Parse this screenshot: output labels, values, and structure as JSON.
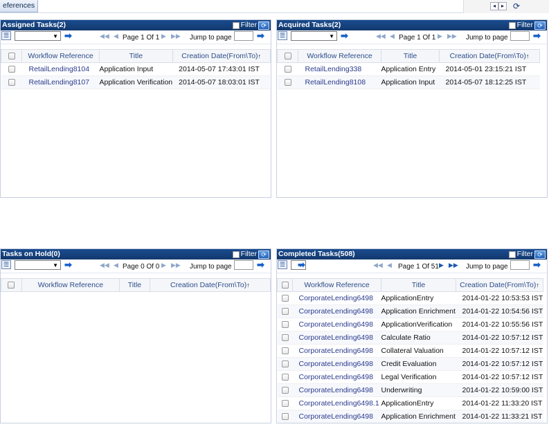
{
  "topbar": {
    "tab_label": "eferences",
    "nav_prev_icon": "◂",
    "nav_next_icon": "▸",
    "refresh_icon": "⟳"
  },
  "common": {
    "filter_label": "Filter",
    "jump_label": "Jump to page",
    "columns": [
      "Workflow Reference",
      "Title",
      "Creation Date(From\\To)"
    ],
    "sort_icon": "↑"
  },
  "panels": {
    "assigned": {
      "title": "Assigned Tasks(2)",
      "page_text": "Page 1 Of 1",
      "rows": [
        {
          "ref": "RetailLending8104",
          "title": "Application Input",
          "date": "2014-05-07 17:43:01 IST"
        },
        {
          "ref": "RetailLending8107",
          "title": "Application Verification",
          "date": "2014-05-07 18:03:01 IST"
        }
      ]
    },
    "acquired": {
      "title": "Acquired Tasks(2)",
      "page_text": "Page 1 Of 1",
      "rows": [
        {
          "ref": "RetailLending338",
          "title": "Application Entry",
          "date": "2014-05-01 23:15:21 IST"
        },
        {
          "ref": "RetailLending8108",
          "title": "Application Input",
          "date": "2014-05-07 18:12:25 IST"
        }
      ]
    },
    "onhold": {
      "title": "Tasks on Hold(0)",
      "page_text": "Page 0 Of 0",
      "rows": []
    },
    "completed": {
      "title": "Completed Tasks(508)",
      "page_text": "Page 1 Of 51",
      "rows": [
        {
          "ref": "CorporateLending6498",
          "title": "ApplicationEntry",
          "date": "2014-01-22 10:53:53 IST"
        },
        {
          "ref": "CorporateLending6498",
          "title": "Application Enrichment",
          "date": "2014-01-22 10:54:56 IST"
        },
        {
          "ref": "CorporateLending6498",
          "title": "ApplicationVerification",
          "date": "2014-01-22 10:55:56 IST"
        },
        {
          "ref": "CorporateLending6498",
          "title": "Calculate Ratio",
          "date": "2014-01-22 10:57:12 IST"
        },
        {
          "ref": "CorporateLending6498",
          "title": "Collateral Valuation",
          "date": "2014-01-22 10:57:12 IST"
        },
        {
          "ref": "CorporateLending6498",
          "title": "Credit Evaluation",
          "date": "2014-01-22 10:57:12 IST"
        },
        {
          "ref": "CorporateLending6498",
          "title": "Legal Verification",
          "date": "2014-01-22 10:57:12 IST"
        },
        {
          "ref": "CorporateLending6498",
          "title": "Underwriting",
          "date": "2014-01-22 10:59:00 IST"
        },
        {
          "ref": "CorporateLending6498.1",
          "title": "ApplicationEntry",
          "date": "2014-01-22 11:33:20 IST"
        },
        {
          "ref": "CorporateLending6498",
          "title": "Application Enrichment",
          "date": "2014-01-22 11:33:21 IST"
        }
      ]
    }
  },
  "colors": {
    "header_bg": "#1a4c8f",
    "link_text": "#2a3a8c",
    "column_header_text": "#2d4c8a"
  }
}
